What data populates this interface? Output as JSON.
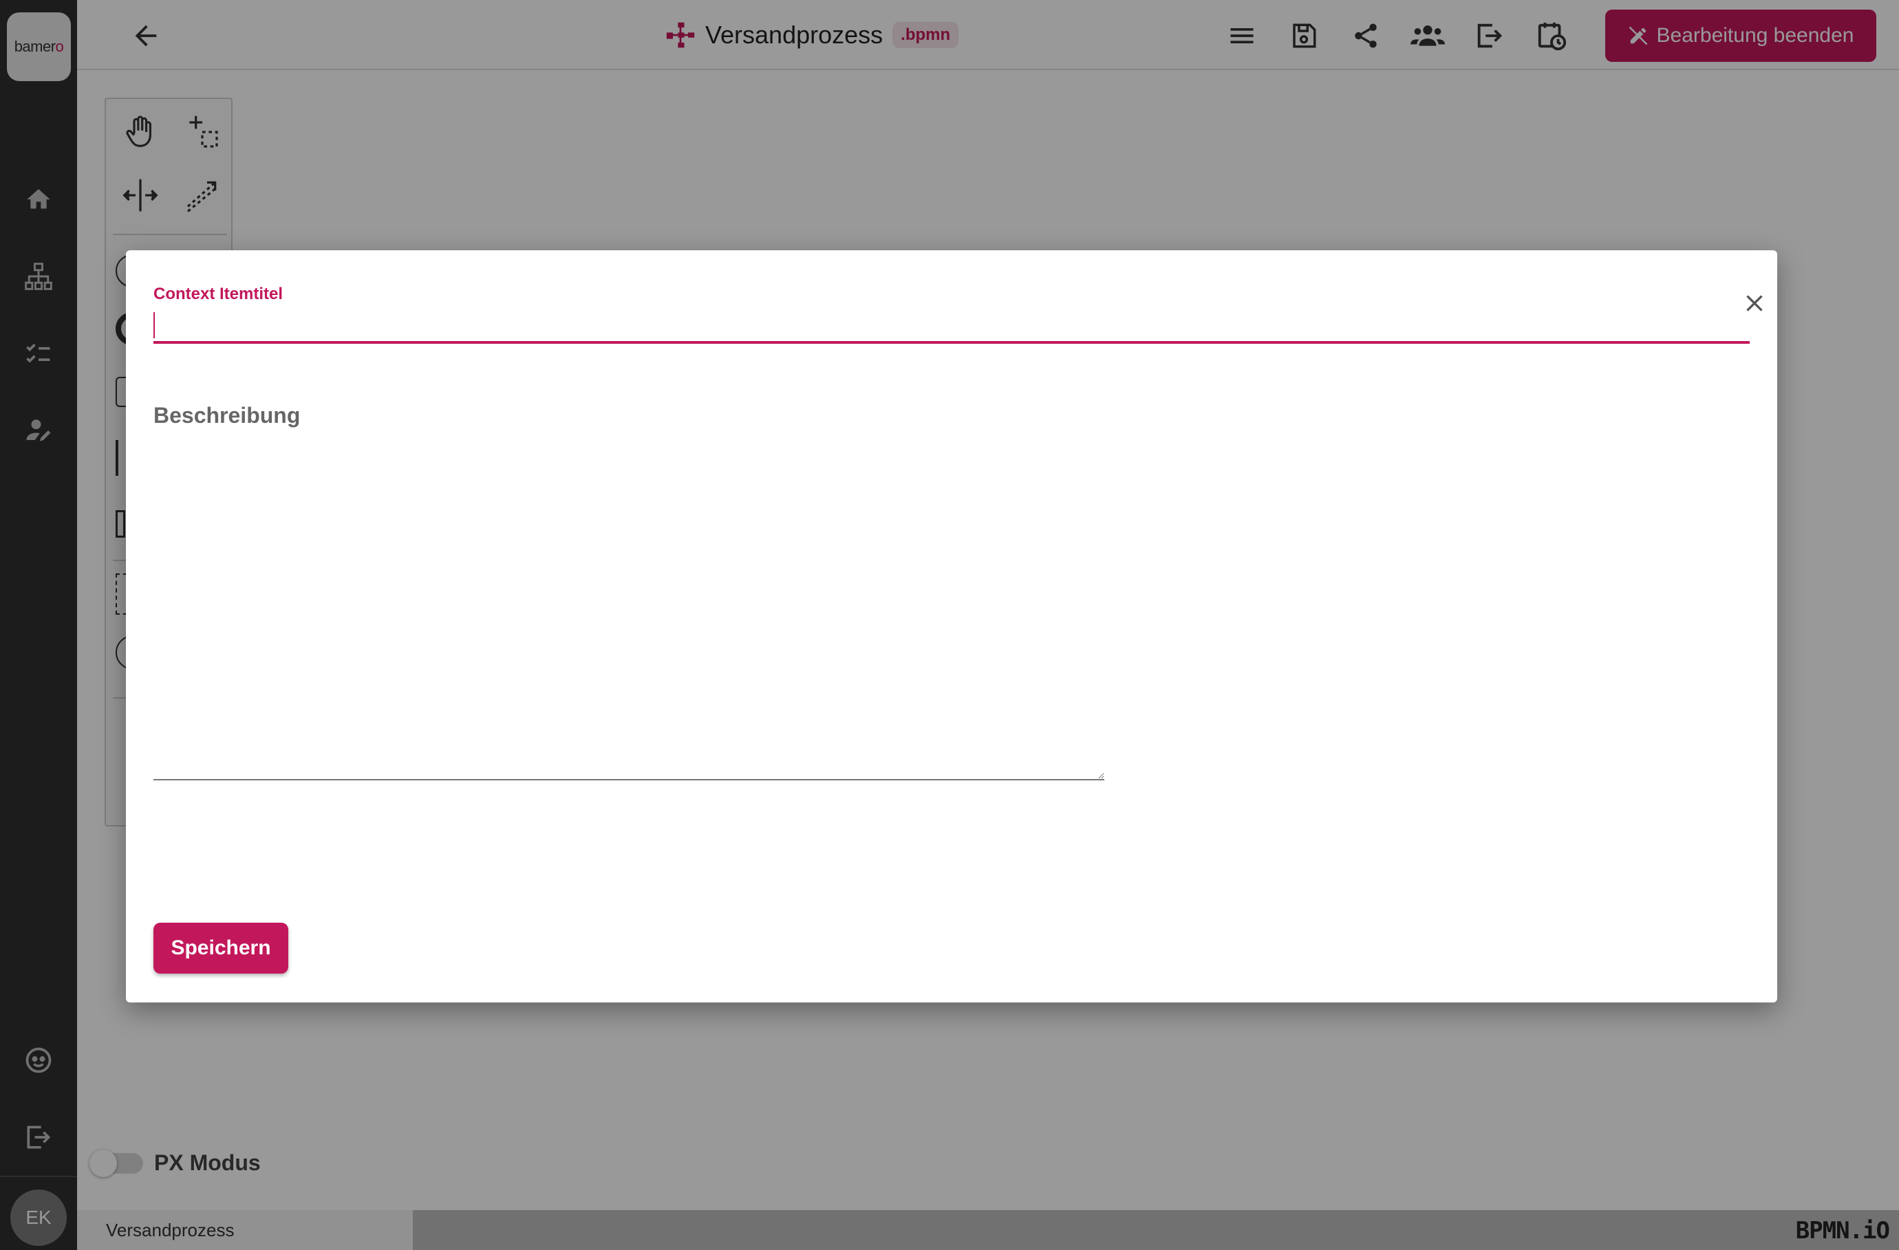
{
  "sidebar": {
    "logo_text": "bamer",
    "logo_accent": "o",
    "items": [
      {
        "icon": "home-icon"
      },
      {
        "icon": "sitemap-icon"
      },
      {
        "icon": "checklist-icon"
      },
      {
        "icon": "user-edit-icon"
      },
      {
        "icon": "support-icon"
      },
      {
        "icon": "logout-icon"
      }
    ],
    "avatar_initials": "EK"
  },
  "header": {
    "title": "Versandprozess",
    "extension": ".bpmn",
    "icons": [
      "menu-icon",
      "save-icon",
      "share-icon",
      "group-icon",
      "export-icon",
      "history-icon"
    ],
    "end_button_label": "Bearbeitung beenden"
  },
  "canvas": {
    "px_mode_label": "PX Modus",
    "px_mode_on": false,
    "tabs": [
      {
        "label": "Versandprozess"
      }
    ],
    "watermark": "BPMN.iO"
  },
  "modal": {
    "title_label": "Context Itemtitel",
    "title_value": "",
    "description_label": "Beschreibung",
    "description_value": "",
    "save_label": "Speichern"
  },
  "colors": {
    "accent": "#c2185b",
    "sidebar_bg": "#303030",
    "overlay": "rgba(0,0,0,0.40)"
  }
}
